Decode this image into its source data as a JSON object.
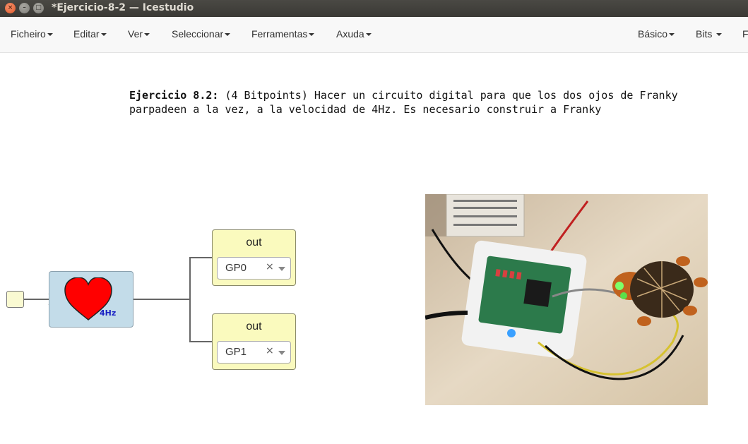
{
  "window": {
    "title": "*Ejercicio-8-2 — Icestudio",
    "close_glyph": "×",
    "min_glyph": "–",
    "max_glyph": "□"
  },
  "menubar": {
    "left": [
      "Ficheiro",
      "Editar",
      "Ver",
      "Seleccionar",
      "Ferramentas",
      "Axuda"
    ],
    "right": [
      "Básico",
      "Bits",
      "F"
    ]
  },
  "description": {
    "bold": "Ejercicio 8.2:",
    "text": " (4 Bitpoints) Hacer un circuito digital para que los dos ojos de Franky parpadeen a la vez, a la velocidad de 4Hz. Es necesario construir a Franky"
  },
  "heart_block": {
    "freq": "4Hz",
    "color": "#ff0000"
  },
  "outputs": [
    {
      "label": "out",
      "pin": "GP0",
      "clear": "×"
    },
    {
      "label": "out",
      "pin": "GP1",
      "clear": "×"
    }
  ],
  "colors": {
    "titlebar": "#3c3b37",
    "heart_block": "#c3dce9",
    "out_block": "#fafabe",
    "input_port": "#fafad2"
  }
}
